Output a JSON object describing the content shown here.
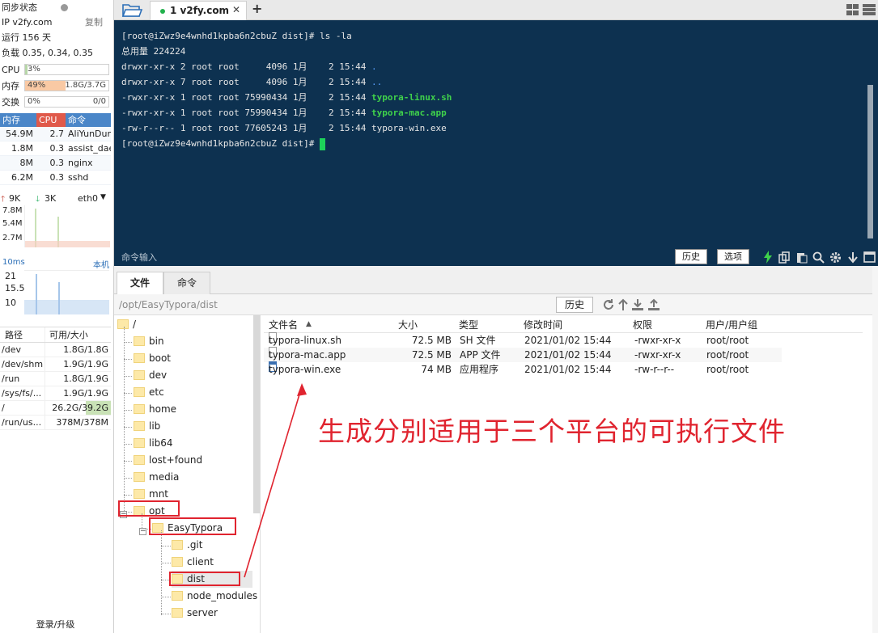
{
  "sidebar": {
    "sync": "同步状态",
    "ip": "IP v2fy.com",
    "copy": "复制",
    "uptime": "运行 156 天",
    "load": "负载 0.35, 0.34, 0.35",
    "cpu": {
      "label": "CPU",
      "pct": "3%",
      "value": 0.03
    },
    "mem": {
      "label": "内存",
      "pct": "49%",
      "right": "1.8G/3.7G",
      "value": 0.49
    },
    "swap": {
      "label": "交换",
      "pct": "0%",
      "right": "0/0",
      "value": 0.0
    },
    "proc_headers": [
      "内存",
      "CPU",
      "命令"
    ],
    "procs": [
      {
        "mem": "54.9M",
        "cpu": "2.7",
        "cmd": "AliYunDun"
      },
      {
        "mem": "1.8M",
        "cpu": "0.3",
        "cmd": "assist_daemon"
      },
      {
        "mem": "8M",
        "cpu": "0.3",
        "cmd": "nginx"
      },
      {
        "mem": "6.2M",
        "cpu": "0.3",
        "cmd": "sshd"
      }
    ],
    "net": {
      "up": "9K",
      "down": "3K",
      "iface": "eth0",
      "scale": [
        "7.8M",
        "5.4M",
        "2.7M"
      ]
    },
    "latency": {
      "label": "10ms",
      "host": "本机",
      "scale": [
        "21",
        "15.5",
        "10"
      ]
    },
    "disk_headers": [
      "路径",
      "可用/大小"
    ],
    "disks": [
      {
        "path": "/dev",
        "size": "1.8G/1.8G"
      },
      {
        "path": "/dev/shm",
        "size": "1.9G/1.9G"
      },
      {
        "path": "/run",
        "size": "1.8G/1.9G"
      },
      {
        "path": "/sys/fs/...",
        "size": "1.9G/1.9G"
      },
      {
        "path": "/",
        "size": "26.2G/39.2G"
      },
      {
        "path": "/run/us...",
        "size": "378M/378M"
      }
    ],
    "login": "登录/升级"
  },
  "tabs": {
    "session": "1 v2fy.com",
    "close": "✕",
    "add": "+"
  },
  "terminal": {
    "prompt1": "[root@iZwz9e4wnhd1kpba6n2cbuZ dist]# ls -la",
    "total": "总用量 224224",
    "entries": [
      {
        "pre": "drwxr-xr-x 2 root root     4096 1月    2 15:44 ",
        "name": ".",
        "style": "dir"
      },
      {
        "pre": "drwxr-xr-x 7 root root     4096 1月    2 15:44 ",
        "name": "..",
        "style": "dir"
      },
      {
        "pre": "-rwxr-xr-x 1 root root 75990434 1月    2 15:44 ",
        "name": "typora-linux.sh",
        "style": "exec"
      },
      {
        "pre": "-rwxr-xr-x 1 root root 75990434 1月    2 15:44 ",
        "name": "typora-mac.app",
        "style": "exec"
      },
      {
        "pre": "-rw-r--r-- 1 root root 77605243 1月    2 15:44 ",
        "name": "typora-win.exe",
        "style": "plain"
      }
    ],
    "prompt2": "[root@iZwz9e4wnhd1kpba6n2cbuZ dist]# ",
    "cmd_input": "命令输入",
    "history_btn": "历史",
    "options_btn": "选项"
  },
  "bottom_tabs": [
    "文件",
    "命令"
  ],
  "pathbar": {
    "path": "/opt/EasyTypora/dist",
    "history": "历史"
  },
  "tree": [
    {
      "label": "/",
      "level": 0
    },
    {
      "label": "bin",
      "level": 1
    },
    {
      "label": "boot",
      "level": 1
    },
    {
      "label": "dev",
      "level": 1
    },
    {
      "label": "etc",
      "level": 1
    },
    {
      "label": "home",
      "level": 1
    },
    {
      "label": "lib",
      "level": 1
    },
    {
      "label": "lib64",
      "level": 1
    },
    {
      "label": "lost+found",
      "level": 1
    },
    {
      "label": "media",
      "level": 1
    },
    {
      "label": "mnt",
      "level": 1
    },
    {
      "label": "opt",
      "level": 1
    },
    {
      "label": "EasyTypora",
      "level": 2
    },
    {
      "label": ".git",
      "level": 3
    },
    {
      "label": "client",
      "level": 3
    },
    {
      "label": "dist",
      "level": 3
    },
    {
      "label": "node_modules",
      "level": 3
    },
    {
      "label": "server",
      "level": 3
    }
  ],
  "files": {
    "headers": [
      "文件名",
      "大小",
      "类型",
      "修改时间",
      "权限",
      "用户/用户组"
    ],
    "rows": [
      {
        "name": "typora-linux.sh",
        "size": "72.5 MB",
        "type": "SH 文件",
        "mtime": "2021/01/02 15:44",
        "perm": "-rwxr-xr-x",
        "owner": "root/root"
      },
      {
        "name": "typora-mac.app",
        "size": "72.5 MB",
        "type": "APP 文件",
        "mtime": "2021/01/02 15:44",
        "perm": "-rwxr-xr-x",
        "owner": "root/root"
      },
      {
        "name": "typora-win.exe",
        "size": "74 MB",
        "type": "应用程序",
        "mtime": "2021/01/02 15:44",
        "perm": "-rw-r--r--",
        "owner": "root/root"
      }
    ]
  },
  "annotation": "生成分别适用于三个平台的可执行文件",
  "colors": {
    "accent_red": "#e0242f",
    "terminal_bg": "#0d3150",
    "exec_green": "#3fd14b",
    "dir_blue": "#5aa0ff"
  }
}
